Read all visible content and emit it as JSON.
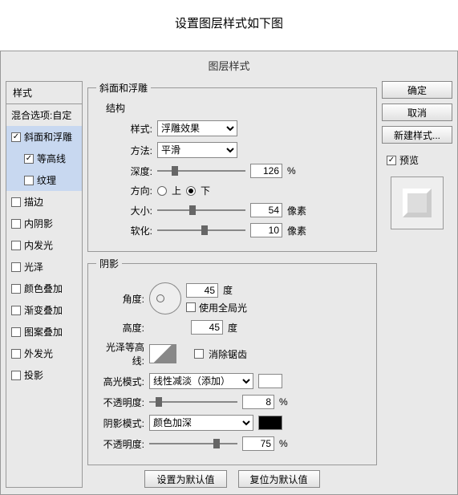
{
  "page_title": "设置图层样式如下图",
  "dialog_title": "图层样式",
  "left": {
    "header": "样式",
    "blend": "混合选项:自定",
    "items": [
      {
        "label": "斜面和浮雕",
        "checked": true,
        "selected": true
      },
      {
        "label": "等高线",
        "checked": true,
        "sub": true,
        "selected": true
      },
      {
        "label": "纹理",
        "checked": false,
        "sub": true,
        "selected": true
      },
      {
        "label": "描边",
        "checked": false
      },
      {
        "label": "内阴影",
        "checked": false
      },
      {
        "label": "内发光",
        "checked": false
      },
      {
        "label": "光泽",
        "checked": false
      },
      {
        "label": "颜色叠加",
        "checked": false
      },
      {
        "label": "渐变叠加",
        "checked": false
      },
      {
        "label": "图案叠加",
        "checked": false
      },
      {
        "label": "外发光",
        "checked": false
      },
      {
        "label": "投影",
        "checked": false
      }
    ]
  },
  "bevel": {
    "legend": "斜面和浮雕",
    "structure": "结构",
    "style_lbl": "样式:",
    "style_val": "浮雕效果",
    "method_lbl": "方法:",
    "method_val": "平滑",
    "depth_lbl": "深度:",
    "depth_val": "126",
    "pct": "%",
    "dir_lbl": "方向:",
    "up": "上",
    "down": "下",
    "size_lbl": "大小:",
    "size_val": "54",
    "px": "像素",
    "soft_lbl": "软化:",
    "soft_val": "10"
  },
  "shade": {
    "legend": "阴影",
    "angle_lbl": "角度:",
    "angle_val": "45",
    "deg": "度",
    "global": "使用全局光",
    "alt_lbl": "高度:",
    "alt_val": "45",
    "contour_lbl": "光泽等高线:",
    "aa": "消除锯齿",
    "hi_lbl": "高光模式:",
    "hi_val": "线性减淡（添加）",
    "hi_op_lbl": "不透明度:",
    "hi_op": "8",
    "sh_lbl": "阴影模式:",
    "sh_val": "颜色加深",
    "sh_op_lbl": "不透明度:",
    "sh_op": "75"
  },
  "btns": {
    "default": "设置为默认值",
    "reset": "复位为默认值"
  },
  "right": {
    "ok": "确定",
    "cancel": "取消",
    "new": "新建样式...",
    "preview": "预览"
  }
}
